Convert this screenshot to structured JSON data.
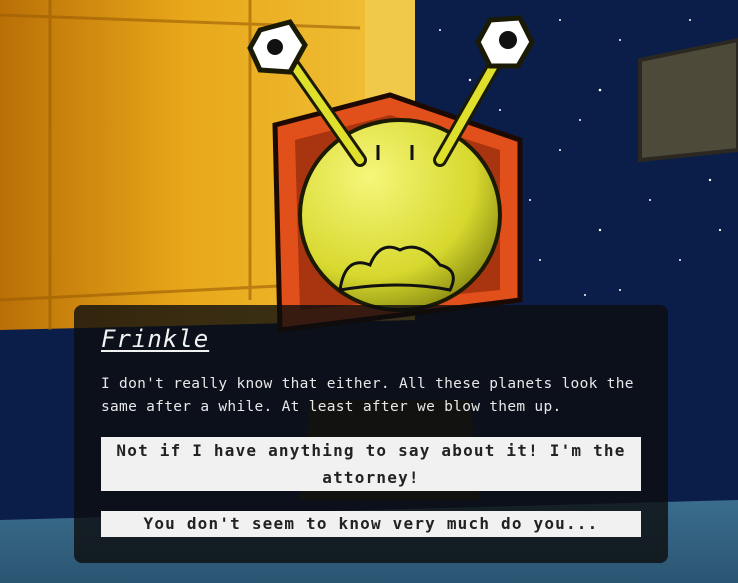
{
  "dialog": {
    "speaker": "Frinkle",
    "line": "I don't really know that either. All these planets look the same after a while. At least after we blow them up.",
    "choices": [
      "Not if I have anything to say about it! I'm the attorney!",
      "You don't seem to know very much do you..."
    ]
  }
}
